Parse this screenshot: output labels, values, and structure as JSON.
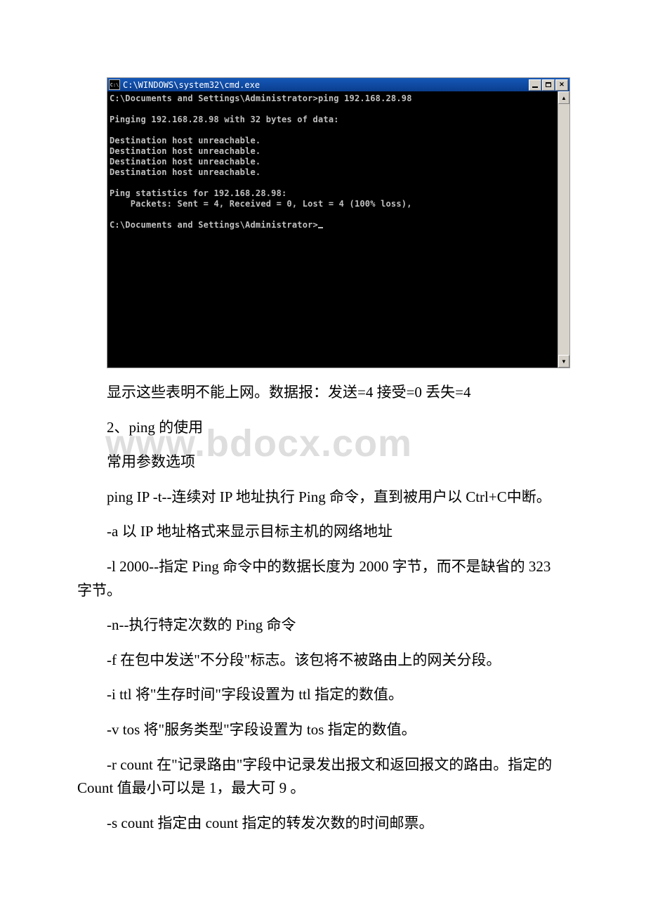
{
  "cmdWindow": {
    "titleIcon": "C:\\",
    "titlePath": "C:\\WINDOWS\\system32\\cmd.exe",
    "lines": [
      "C:\\Documents and Settings\\Administrator>ping 192.168.28.98",
      "",
      "Pinging 192.168.28.98 with 32 bytes of data:",
      "",
      "Destination host unreachable.",
      "Destination host unreachable.",
      "Destination host unreachable.",
      "Destination host unreachable.",
      "",
      "Ping statistics for 192.168.28.98:",
      "    Packets: Sent = 4, Received = 0, Lost = 4 (100% loss),",
      "",
      "C:\\Documents and Settings\\Administrator>"
    ]
  },
  "watermark": "www.bdocx.com",
  "doc": {
    "p1": "显示这些表明不能上网。数据报：发送=4 接受=0 丢失=4",
    "p2": "2、ping 的使用",
    "p3": "常用参数选项",
    "p4": "ping IP -t--连续对 IP 地址执行 Ping 命令，直到被用户以 Ctrl+C中断。",
    "p5": "-a 以 IP 地址格式来显示目标主机的网络地址",
    "p6": " -l 2000--指定 Ping 命令中的数据长度为 2000 字节，而不是缺省的 323 字节。",
    "p7": "-n--执行特定次数的 Ping 命令",
    "p8": "-f 在包中发送\"不分段\"标志。该包将不被路由上的网关分段。",
    "p9": "-i ttl 将\"生存时间\"字段设置为 ttl 指定的数值。",
    "p10": "-v tos 将\"服务类型\"字段设置为 tos 指定的数值。",
    "p11": "-r count 在\"记录路由\"字段中记录发出报文和返回报文的路由。指定的 Count 值最小可以是 1，最大可 9 。",
    "p12": "-s count 指定由 count 指定的转发次数的时间邮票。"
  }
}
